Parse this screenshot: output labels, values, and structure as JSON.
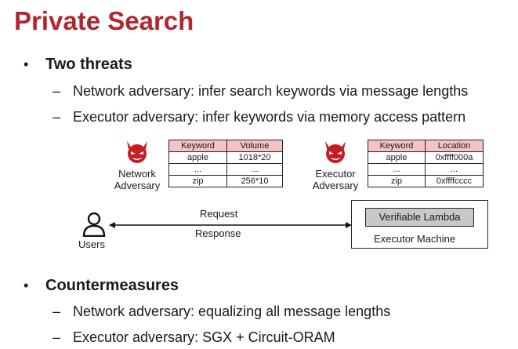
{
  "title": "Private Search",
  "bullets": [
    {
      "marker": "•",
      "text": "Two threats",
      "subs": [
        {
          "marker": "–",
          "text": "Network adversary: infer search keywords via message lengths"
        },
        {
          "marker": "–",
          "text": "Executor adversary: infer keywords via memory access pattern"
        }
      ]
    },
    {
      "marker": "•",
      "text": "Countermeasures",
      "subs": [
        {
          "marker": "–",
          "text": "Network adversary: equalizing all message lengths"
        },
        {
          "marker": "–",
          "text": "Executor adversary: SGX + Circuit-ORAM"
        }
      ]
    }
  ],
  "diagram": {
    "network": {
      "label_line1": "Network",
      "label_line2": "Adversary",
      "headers": [
        "Keyword",
        "Volume"
      ],
      "rows": [
        [
          "apple",
          "1018*20"
        ],
        [
          "...",
          "..."
        ],
        [
          "zip",
          "256*10"
        ]
      ]
    },
    "executor": {
      "label_line1": "Executor",
      "label_line2": "Adversary",
      "headers": [
        "Keyword",
        "Location"
      ],
      "rows": [
        [
          "apple",
          "0xffff000a"
        ],
        [
          "...",
          "..."
        ],
        [
          "zip",
          "0xffffcccc"
        ]
      ]
    },
    "users_label": "Users",
    "request_label": "Request",
    "response_label": "Response",
    "lambda_label": "Verifiable Lambda",
    "executor_machine_label": "Executor Machine"
  },
  "colors": {
    "title": "#b3262e",
    "table_header": "#f5c2c6",
    "devil": "#c41e24",
    "lambda_fill": "#c8c8c8"
  },
  "icons": [
    "devil-icon",
    "user-icon"
  ]
}
